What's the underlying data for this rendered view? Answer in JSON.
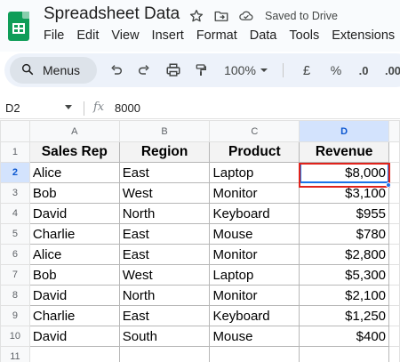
{
  "header": {
    "doc_title": "Spreadsheet Data",
    "saved_status": "Saved to Drive"
  },
  "menu": [
    "File",
    "Edit",
    "View",
    "Insert",
    "Format",
    "Data",
    "Tools",
    "Extensions"
  ],
  "toolbar": {
    "search_label": "Menus",
    "zoom": "100%",
    "currency": "£",
    "percent": "%",
    "decrease_decimals": ".0",
    "increase_decimals": ".00"
  },
  "formula_bar": {
    "name_box": "D2",
    "fx_label": "fx",
    "value": "8000"
  },
  "grid": {
    "columns": [
      "A",
      "B",
      "C",
      "D"
    ],
    "rows": [
      "1",
      "2",
      "3",
      "4",
      "5",
      "6",
      "7",
      "8",
      "9",
      "10",
      "11"
    ],
    "headers": [
      "Sales Rep",
      "Region",
      "Product",
      "Revenue"
    ],
    "data": [
      [
        "Alice",
        "East",
        "Laptop",
        "$8,000"
      ],
      [
        "Bob",
        "West",
        "Monitor",
        "$3,100"
      ],
      [
        "David",
        "North",
        "Keyboard",
        "$955"
      ],
      [
        "Charlie",
        "East",
        "Mouse",
        "$780"
      ],
      [
        "Alice",
        "East",
        "Monitor",
        "$2,800"
      ],
      [
        "Bob",
        "West",
        "Laptop",
        "$5,300"
      ],
      [
        "David",
        "North",
        "Monitor",
        "$2,100"
      ],
      [
        "Charlie",
        "East",
        "Keyboard",
        "$1,250"
      ],
      [
        "David",
        "South",
        "Mouse",
        "$400"
      ]
    ]
  },
  "colors": {
    "selection_blue": "#1a73e8",
    "highlight_red": "#e0231c",
    "sheets_green": "#0f9d58"
  }
}
